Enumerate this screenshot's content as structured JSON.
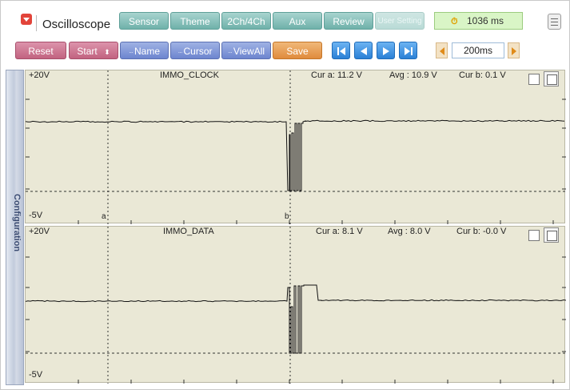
{
  "app": {
    "title": "Oscilloscope"
  },
  "tabs": [
    {
      "label": "Sensor"
    },
    {
      "label": "Theme"
    },
    {
      "label": "2Ch/4Ch"
    },
    {
      "label": "Aux"
    },
    {
      "label": "Review"
    },
    {
      "label": "User Setting",
      "disabled": true
    }
  ],
  "timer": {
    "icon": "stopwatch-icon",
    "value": "1036 ms"
  },
  "controls": {
    "reset": "Reset",
    "start": "Start",
    "name": "Name",
    "cursor": "Cursor",
    "viewall": "ViewAll",
    "save": "Save"
  },
  "playback": [
    "first-frame-icon",
    "prev-icon",
    "play-icon",
    "last-frame-icon"
  ],
  "timebase": {
    "value": "200ms"
  },
  "side_panel": {
    "label": "Configuration"
  },
  "channels": [
    {
      "name": "IMMO_CLOCK",
      "vmax": "+20V",
      "vmin": "-5V",
      "cur_a": "Cur a: 11.2 V",
      "avg": "Avg  : 10.9 V",
      "cur_b": "Cur b: 0.1 V",
      "cursor_a_label": "a",
      "cursor_b_label": "b"
    },
    {
      "name": "IMMO_DATA",
      "vmax": "+20V",
      "vmin": "-5V",
      "cur_a": "Cur a: 8.1 V",
      "avg": "Avg  : 8.0 V",
      "cur_b": "Cur b: -0.0 V"
    }
  ],
  "colors": {
    "tab": "#6fb1aa",
    "pink": "#c26380",
    "blue": "#6d85cf",
    "orange": "#e08b3c",
    "nav": "#2a80d6",
    "plot_bg": "#eae8d6",
    "trace": "#111111"
  }
}
